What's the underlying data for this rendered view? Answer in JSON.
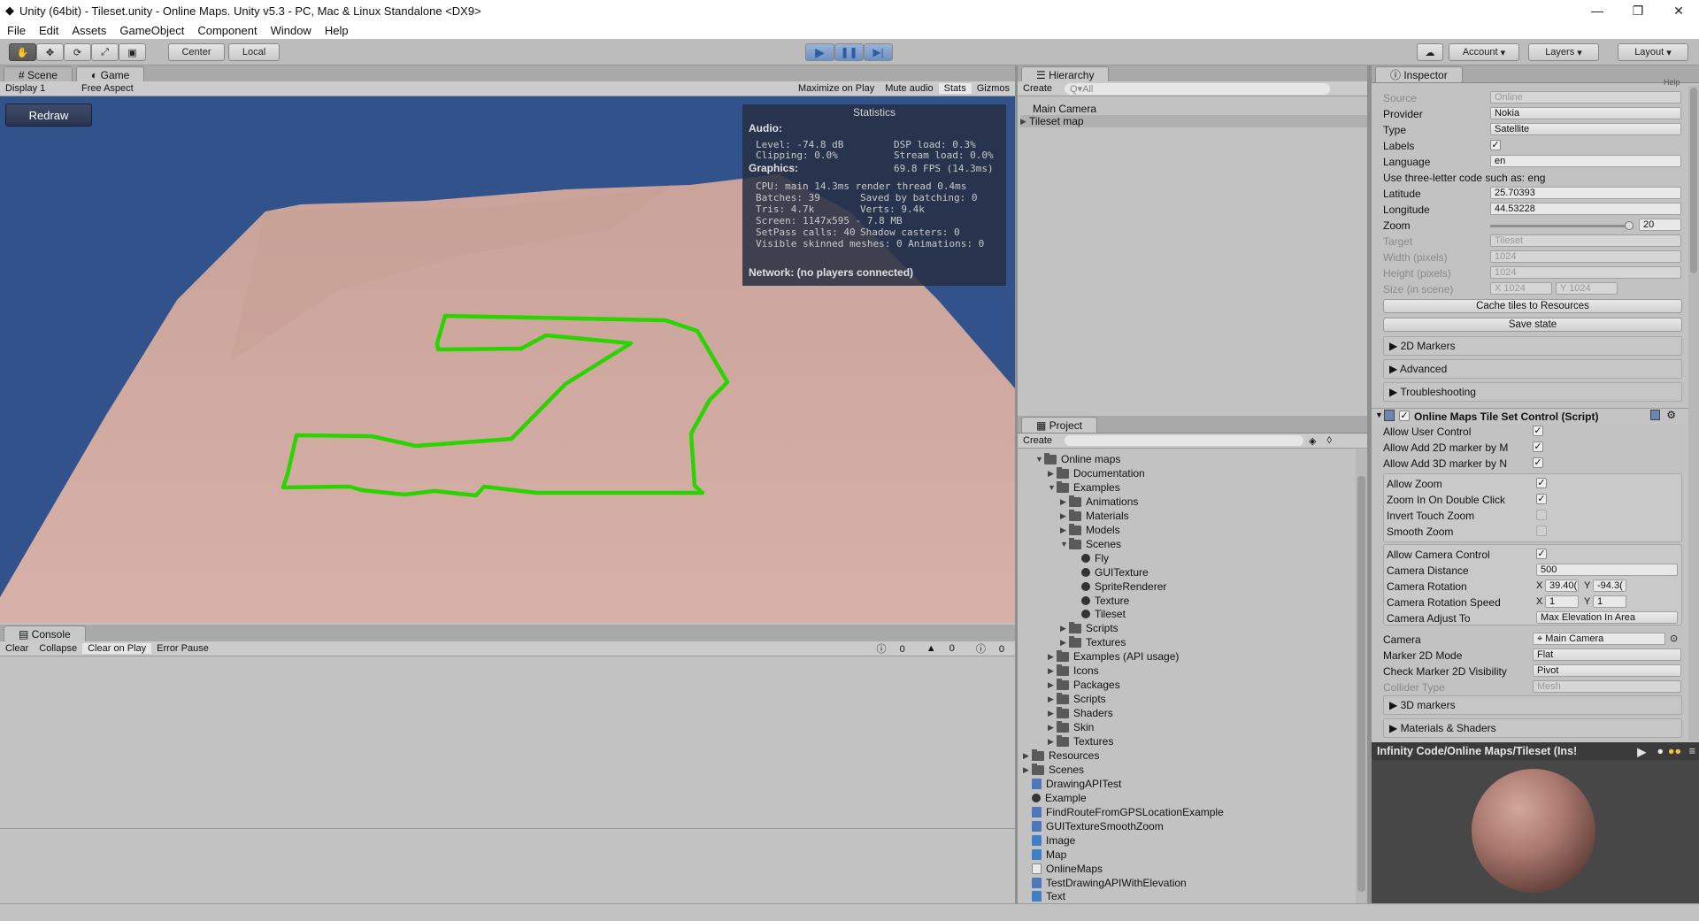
{
  "window": {
    "title": "Unity (64bit) - Tileset.unity - Online Maps. Unity v5.3 - PC, Mac & Linux Standalone <DX9>",
    "min": "—",
    "max": "❐",
    "close": "✕"
  },
  "menu": [
    "File",
    "Edit",
    "Assets",
    "GameObject",
    "Component",
    "Window",
    "Help"
  ],
  "toolbar": {
    "pivot": "Center",
    "space": "Local",
    "account": "Account",
    "layers": "Layers",
    "layout": "Layout",
    "play_icon": "play-icon",
    "pause_icon": "pause-icon",
    "step_icon": "step-icon"
  },
  "scene_tabs": {
    "scene": "Scene",
    "game": "Game"
  },
  "game_bar": {
    "display": "Display 1",
    "aspect": "Free Aspect",
    "maximize": "Maximize on Play",
    "mute": "Mute audio",
    "stats": "Stats",
    "gizmos": "Gizmos"
  },
  "redraw": "Redraw",
  "stats": {
    "title": "Statistics",
    "audio": "Audio:",
    "level": "Level: -74.8 dB",
    "clipping": "Clipping: 0.0%",
    "dsp": "DSP load: 0.3%",
    "stream": "Stream load: 0.0%",
    "graphics": "Graphics:",
    "fps": "69.8 FPS (14.3ms)",
    "cpu": "CPU: main 14.3ms  render thread 0.4ms",
    "batches": "Batches: 39",
    "saved": "Saved by batching: 0",
    "tris": "Tris: 4.7k",
    "verts": "Verts: 9.4k",
    "screen": "Screen: 1147x595 - 7.8 MB",
    "setpass": "SetPass calls: 40",
    "shadow": "Shadow casters: 0",
    "skinned": "Visible skinned meshes: 0  Animations: 0",
    "network": "Network: (no players connected)"
  },
  "console": {
    "tab": "Console",
    "clear": "Clear",
    "collapse": "Collapse",
    "clear_on_play": "Clear on Play",
    "error_pause": "Error Pause",
    "errors": "0",
    "warnings": "0",
    "logs": "0"
  },
  "hierarchy": {
    "tab": "Hierarchy",
    "create": "Create",
    "search": "Q▾All",
    "items": [
      "Main Camera",
      "Tileset map"
    ]
  },
  "project": {
    "tab": "Project",
    "create": "Create",
    "items": [
      {
        "label": "Online maps",
        "depth": 1,
        "open": true,
        "kind": "folder"
      },
      {
        "label": "Documentation",
        "depth": 2,
        "kind": "folder"
      },
      {
        "label": "Examples",
        "depth": 2,
        "open": true,
        "kind": "folder"
      },
      {
        "label": "Animations",
        "depth": 3,
        "kind": "folder"
      },
      {
        "label": "Materials",
        "depth": 3,
        "kind": "folder"
      },
      {
        "label": "Models",
        "depth": 3,
        "kind": "folder"
      },
      {
        "label": "Scenes",
        "depth": 3,
        "open": true,
        "kind": "folder"
      },
      {
        "label": "Fly",
        "depth": 4,
        "kind": "unity"
      },
      {
        "label": "GUITexture",
        "depth": 4,
        "kind": "unity"
      },
      {
        "label": "SpriteRenderer",
        "depth": 4,
        "kind": "unity"
      },
      {
        "label": "Texture",
        "depth": 4,
        "kind": "unity"
      },
      {
        "label": "Tileset",
        "depth": 4,
        "kind": "unity"
      },
      {
        "label": "Scripts",
        "depth": 3,
        "kind": "folder"
      },
      {
        "label": "Textures",
        "depth": 3,
        "kind": "folder"
      },
      {
        "label": "Examples (API usage)",
        "depth": 2,
        "kind": "folder"
      },
      {
        "label": "Icons",
        "depth": 2,
        "kind": "folder"
      },
      {
        "label": "Packages",
        "depth": 2,
        "kind": "folder"
      },
      {
        "label": "Scripts",
        "depth": 2,
        "kind": "folder"
      },
      {
        "label": "Shaders",
        "depth": 2,
        "kind": "folder"
      },
      {
        "label": "Skin",
        "depth": 2,
        "kind": "folder"
      },
      {
        "label": "Textures",
        "depth": 2,
        "kind": "folder"
      },
      {
        "label": "Resources",
        "depth": 0,
        "kind": "folder"
      },
      {
        "label": "Scenes",
        "depth": 0,
        "kind": "folder"
      },
      {
        "label": "DrawingAPITest",
        "depth": 0,
        "kind": "script"
      },
      {
        "label": "Example",
        "depth": 0,
        "kind": "unity"
      },
      {
        "label": "FindRouteFromGPSLocationExample",
        "depth": 0,
        "kind": "script"
      },
      {
        "label": "GUITextureSmoothZoom",
        "depth": 0,
        "kind": "script"
      },
      {
        "label": "Image",
        "depth": 0,
        "kind": "prefab"
      },
      {
        "label": "Map",
        "depth": 0,
        "kind": "prefab"
      },
      {
        "label": "OnlineMaps",
        "depth": 0,
        "kind": "texture"
      },
      {
        "label": "TestDrawingAPIWithElevation",
        "depth": 0,
        "kind": "script"
      },
      {
        "label": "Text",
        "depth": 0,
        "kind": "prefab"
      }
    ]
  },
  "inspector": {
    "tab": "Inspector",
    "help": "Help",
    "source_label": "Source",
    "source": "Online",
    "provider_label": "Provider",
    "provider": "Nokia",
    "type_label": "Type",
    "type": "Satellite",
    "labels_label": "Labels",
    "language_label": "Language",
    "language": "en",
    "lang_hint": "Use three-letter code such as: eng",
    "lat_label": "Latitude",
    "lat": "25.70393",
    "lon_label": "Longitude",
    "lon": "44.53228",
    "zoom_label": "Zoom",
    "zoom": "20",
    "target_label": "Target",
    "target": "Tileset",
    "width_label": "Width (pixels)",
    "width": "1024",
    "height_label": "Height (pixels)",
    "height": "1024",
    "size_label": "Size (in scene)",
    "size_x": "X 1024",
    "size_y": "Y 1024",
    "cache_btn": "Cache tiles to Resources",
    "save_btn": "Save state",
    "fold_2d": "2D Markers",
    "fold_adv": "Advanced",
    "fold_trouble": "Troubleshooting",
    "component": "Online Maps Tile Set Control (Script)",
    "allow_user": "Allow User Control",
    "allow_2d": "Allow Add 2D marker by M",
    "allow_3d": "Allow Add 3D marker by N",
    "allow_zoom": "Allow Zoom",
    "zoom_dbl": "Zoom In On Double Click",
    "invert_touch": "Invert Touch Zoom",
    "smooth_zoom": "Smooth Zoom",
    "allow_cam": "Allow Camera Control",
    "cam_dist_label": "Camera Distance",
    "cam_dist": "500",
    "cam_rot_label": "Camera Rotation",
    "cam_rot_x": "39.40(",
    "cam_rot_y": "-94.3(",
    "cam_speed_label": "Camera Rotation Speed",
    "cam_speed_x": "1",
    "cam_speed_y": "1",
    "cam_adjust_label": "Camera Adjust To",
    "cam_adjust": "Max Elevation In Area",
    "camera_label": "Camera",
    "camera": "Main Camera",
    "marker2d_label": "Marker 2D Mode",
    "marker2d": "Flat",
    "check2d_label": "Check Marker 2D Visibility",
    "check2d": "Pivot",
    "collider_label": "Collider Type",
    "collider": "Mesh",
    "fold_3d": "3D markers",
    "fold_mat": "Materials & Shaders",
    "preview_title": "Infinity Code/Online Maps/Tileset (Ins!"
  }
}
